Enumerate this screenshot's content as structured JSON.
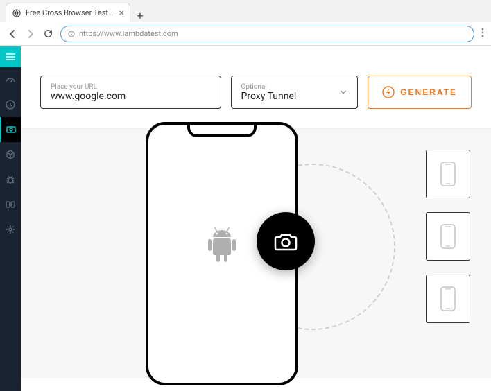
{
  "browser": {
    "tab_title": "Free Cross Browser Testing Clou",
    "url": "https://www.lambdatest.com"
  },
  "controls": {
    "url_label": "Place your URL",
    "url_value": "www.google.com",
    "proxy_label": "Optional",
    "proxy_value": "Proxy Tunnel",
    "generate_label": "GENERATE"
  },
  "sidebar": {
    "items": [
      {
        "name": "dashboard"
      },
      {
        "name": "history"
      },
      {
        "name": "screenshot",
        "active": true
      },
      {
        "name": "box"
      },
      {
        "name": "bug"
      },
      {
        "name": "integrations"
      },
      {
        "name": "settings"
      }
    ]
  }
}
